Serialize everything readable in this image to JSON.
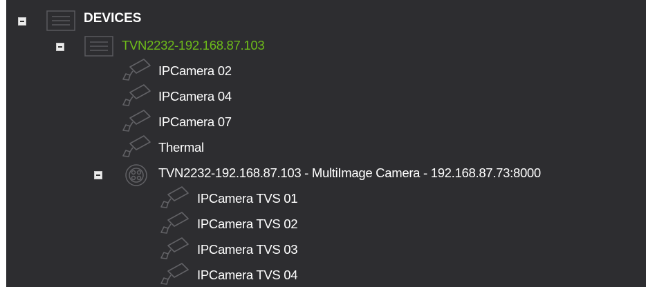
{
  "tree": {
    "root": {
      "label": "DEVICES",
      "expanded": true,
      "icon": "list-box-icon"
    },
    "recorder": {
      "label": "TVN2232-192.168.87.103",
      "expanded": true,
      "icon": "list-box-icon",
      "color": "#6dbb1a"
    },
    "cameras": [
      {
        "label": "IPCamera 02",
        "icon": "camera-icon"
      },
      {
        "label": "IPCamera 04",
        "icon": "camera-icon"
      },
      {
        "label": "IPCamera 07",
        "icon": "camera-icon"
      },
      {
        "label": "Thermal",
        "icon": "camera-icon"
      }
    ],
    "multi": {
      "label": "TVN2232-192.168.87.103 - MultiImage Camera - 192.168.87.73:8000",
      "expanded": true,
      "icon": "multi-image-camera-icon",
      "children": [
        {
          "label": "IPCamera TVS 01",
          "icon": "camera-icon"
        },
        {
          "label": "IPCamera TVS 02",
          "icon": "camera-icon"
        },
        {
          "label": "IPCamera TVS 03",
          "icon": "camera-icon"
        },
        {
          "label": "IPCamera TVS 04",
          "icon": "camera-icon"
        }
      ]
    }
  }
}
